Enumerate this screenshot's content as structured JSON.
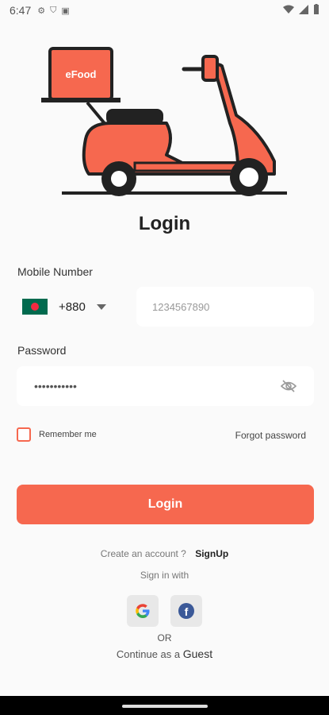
{
  "status_bar": {
    "time": "6:47"
  },
  "illustration": {
    "box_label": "eFood"
  },
  "page": {
    "title": "Login"
  },
  "mobile": {
    "label": "Mobile Number",
    "dial_code": "+880",
    "placeholder": "1234567890"
  },
  "password": {
    "label": "Password",
    "value": "•••••••••••"
  },
  "remember_me": {
    "label": "Remember me",
    "checked": false
  },
  "forgot_password": {
    "label": "Forgot password"
  },
  "login_button": {
    "label": "Login"
  },
  "signup_prompt": {
    "text": "Create an account ?",
    "link": "SignUp"
  },
  "social": {
    "heading": "Sign in with",
    "providers": [
      "google-icon",
      "facebook-icon"
    ]
  },
  "divider": {
    "or_label": "OR"
  },
  "guest": {
    "prefix": "Continue as a",
    "link": "Guest"
  },
  "colors": {
    "accent": "#f6684f",
    "background": "#fafafa",
    "facebook": "#3b5998"
  }
}
